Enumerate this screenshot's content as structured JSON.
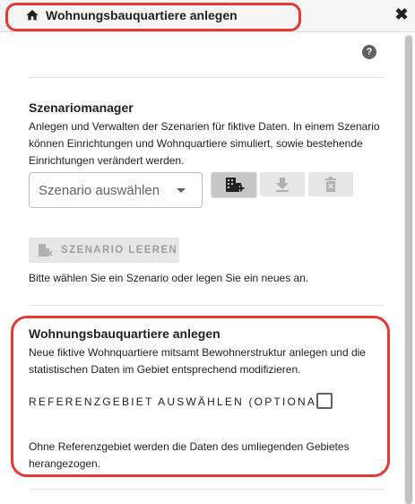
{
  "header": {
    "title": "Wohnungsbauquartiere anlegen",
    "home_icon": "home-icon",
    "close_label": "✖"
  },
  "help": {
    "label": "?"
  },
  "scenario_manager": {
    "title": "Szenariomanager",
    "description": "Anlegen und Verwalten der Szenarien für fiktive Daten. In einem Szenario können Einrichtungen und Wohnquartiere simuliert, sowie bestehende Einrichtungen verändert werden.",
    "select": {
      "value": "Szenario auswählen"
    },
    "clear_button_label": "SZENARIO LEEREN",
    "hint": "Bitte wählen Sie ein Szenario oder legen Sie ein neues an."
  },
  "housing_section": {
    "title": "Wohnungsbauquartiere anlegen",
    "description": "Neue fiktive Wohnquartiere mitsamt Bewohnerstruktur anlegen und die statistischen Daten im Gebiet entsprechend modifizieren.",
    "checkbox_label": "REFERENZGEBIET AUSWÄHLEN (OPTIONAL)",
    "note": "Ohne Referenzgebiet werden die Daten des umliegenden Gebietes herangezogen."
  },
  "colors": {
    "annotation": "#e53935",
    "header_bg": "#f5f5f5",
    "button_bg": "#e6e6e6",
    "button_active": "#c7c7c7"
  }
}
